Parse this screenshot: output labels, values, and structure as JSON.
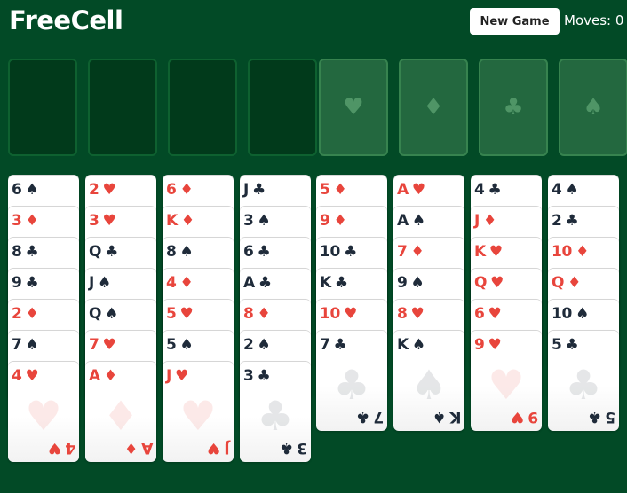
{
  "header": {
    "title": "FreeCell",
    "new_game_label": "New Game",
    "moves_text": "Moves: 0"
  },
  "freecells": [
    {
      "card": null
    },
    {
      "card": null
    },
    {
      "card": null
    },
    {
      "card": null
    }
  ],
  "foundations": [
    {
      "suit": "♥",
      "suit_name": "hearts"
    },
    {
      "suit": "♦",
      "suit_name": "diamonds"
    },
    {
      "suit": "♣",
      "suit_name": "clubs"
    },
    {
      "suit": "♠",
      "suit_name": "spades"
    }
  ],
  "colors": {
    "table": "#024a26",
    "red_suit": "#e8453c",
    "black_suit": "#1f2b3a"
  },
  "tableau": [
    [
      {
        "rank": "6",
        "suit": "♠",
        "color": "black"
      },
      {
        "rank": "3",
        "suit": "♦",
        "color": "red"
      },
      {
        "rank": "8",
        "suit": "♣",
        "color": "black"
      },
      {
        "rank": "9",
        "suit": "♣",
        "color": "black"
      },
      {
        "rank": "2",
        "suit": "♦",
        "color": "red"
      },
      {
        "rank": "7",
        "suit": "♠",
        "color": "black"
      },
      {
        "rank": "4",
        "suit": "♥",
        "color": "red"
      }
    ],
    [
      {
        "rank": "2",
        "suit": "♥",
        "color": "red"
      },
      {
        "rank": "3",
        "suit": "♥",
        "color": "red"
      },
      {
        "rank": "Q",
        "suit": "♣",
        "color": "black"
      },
      {
        "rank": "J",
        "suit": "♠",
        "color": "black"
      },
      {
        "rank": "Q",
        "suit": "♠",
        "color": "black"
      },
      {
        "rank": "7",
        "suit": "♥",
        "color": "red"
      },
      {
        "rank": "A",
        "suit": "♦",
        "color": "red"
      }
    ],
    [
      {
        "rank": "6",
        "suit": "♦",
        "color": "red"
      },
      {
        "rank": "K",
        "suit": "♦",
        "color": "red"
      },
      {
        "rank": "8",
        "suit": "♠",
        "color": "black"
      },
      {
        "rank": "4",
        "suit": "♦",
        "color": "red"
      },
      {
        "rank": "5",
        "suit": "♥",
        "color": "red"
      },
      {
        "rank": "5",
        "suit": "♠",
        "color": "black"
      },
      {
        "rank": "J",
        "suit": "♥",
        "color": "red"
      }
    ],
    [
      {
        "rank": "J",
        "suit": "♣",
        "color": "black"
      },
      {
        "rank": "3",
        "suit": "♠",
        "color": "black"
      },
      {
        "rank": "6",
        "suit": "♣",
        "color": "black"
      },
      {
        "rank": "A",
        "suit": "♣",
        "color": "black"
      },
      {
        "rank": "8",
        "suit": "♦",
        "color": "red"
      },
      {
        "rank": "2",
        "suit": "♠",
        "color": "black"
      },
      {
        "rank": "3",
        "suit": "♣",
        "color": "black"
      }
    ],
    [
      {
        "rank": "5",
        "suit": "♦",
        "color": "red"
      },
      {
        "rank": "9",
        "suit": "♦",
        "color": "red"
      },
      {
        "rank": "10",
        "suit": "♣",
        "color": "black"
      },
      {
        "rank": "K",
        "suit": "♣",
        "color": "black"
      },
      {
        "rank": "10",
        "suit": "♥",
        "color": "red"
      },
      {
        "rank": "7",
        "suit": "♣",
        "color": "black"
      }
    ],
    [
      {
        "rank": "A",
        "suit": "♥",
        "color": "red"
      },
      {
        "rank": "A",
        "suit": "♠",
        "color": "black"
      },
      {
        "rank": "7",
        "suit": "♦",
        "color": "red"
      },
      {
        "rank": "9",
        "suit": "♠",
        "color": "black"
      },
      {
        "rank": "8",
        "suit": "♥",
        "color": "red"
      },
      {
        "rank": "K",
        "suit": "♠",
        "color": "black"
      }
    ],
    [
      {
        "rank": "4",
        "suit": "♣",
        "color": "black"
      },
      {
        "rank": "J",
        "suit": "♦",
        "color": "red"
      },
      {
        "rank": "K",
        "suit": "♥",
        "color": "red"
      },
      {
        "rank": "Q",
        "suit": "♥",
        "color": "red"
      },
      {
        "rank": "6",
        "suit": "♥",
        "color": "red"
      },
      {
        "rank": "9",
        "suit": "♥",
        "color": "red"
      }
    ],
    [
      {
        "rank": "4",
        "suit": "♠",
        "color": "black"
      },
      {
        "rank": "2",
        "suit": "♣",
        "color": "black"
      },
      {
        "rank": "10",
        "suit": "♦",
        "color": "red"
      },
      {
        "rank": "Q",
        "suit": "♦",
        "color": "red"
      },
      {
        "rank": "10",
        "suit": "♠",
        "color": "black"
      },
      {
        "rank": "5",
        "suit": "♣",
        "color": "black"
      }
    ]
  ]
}
